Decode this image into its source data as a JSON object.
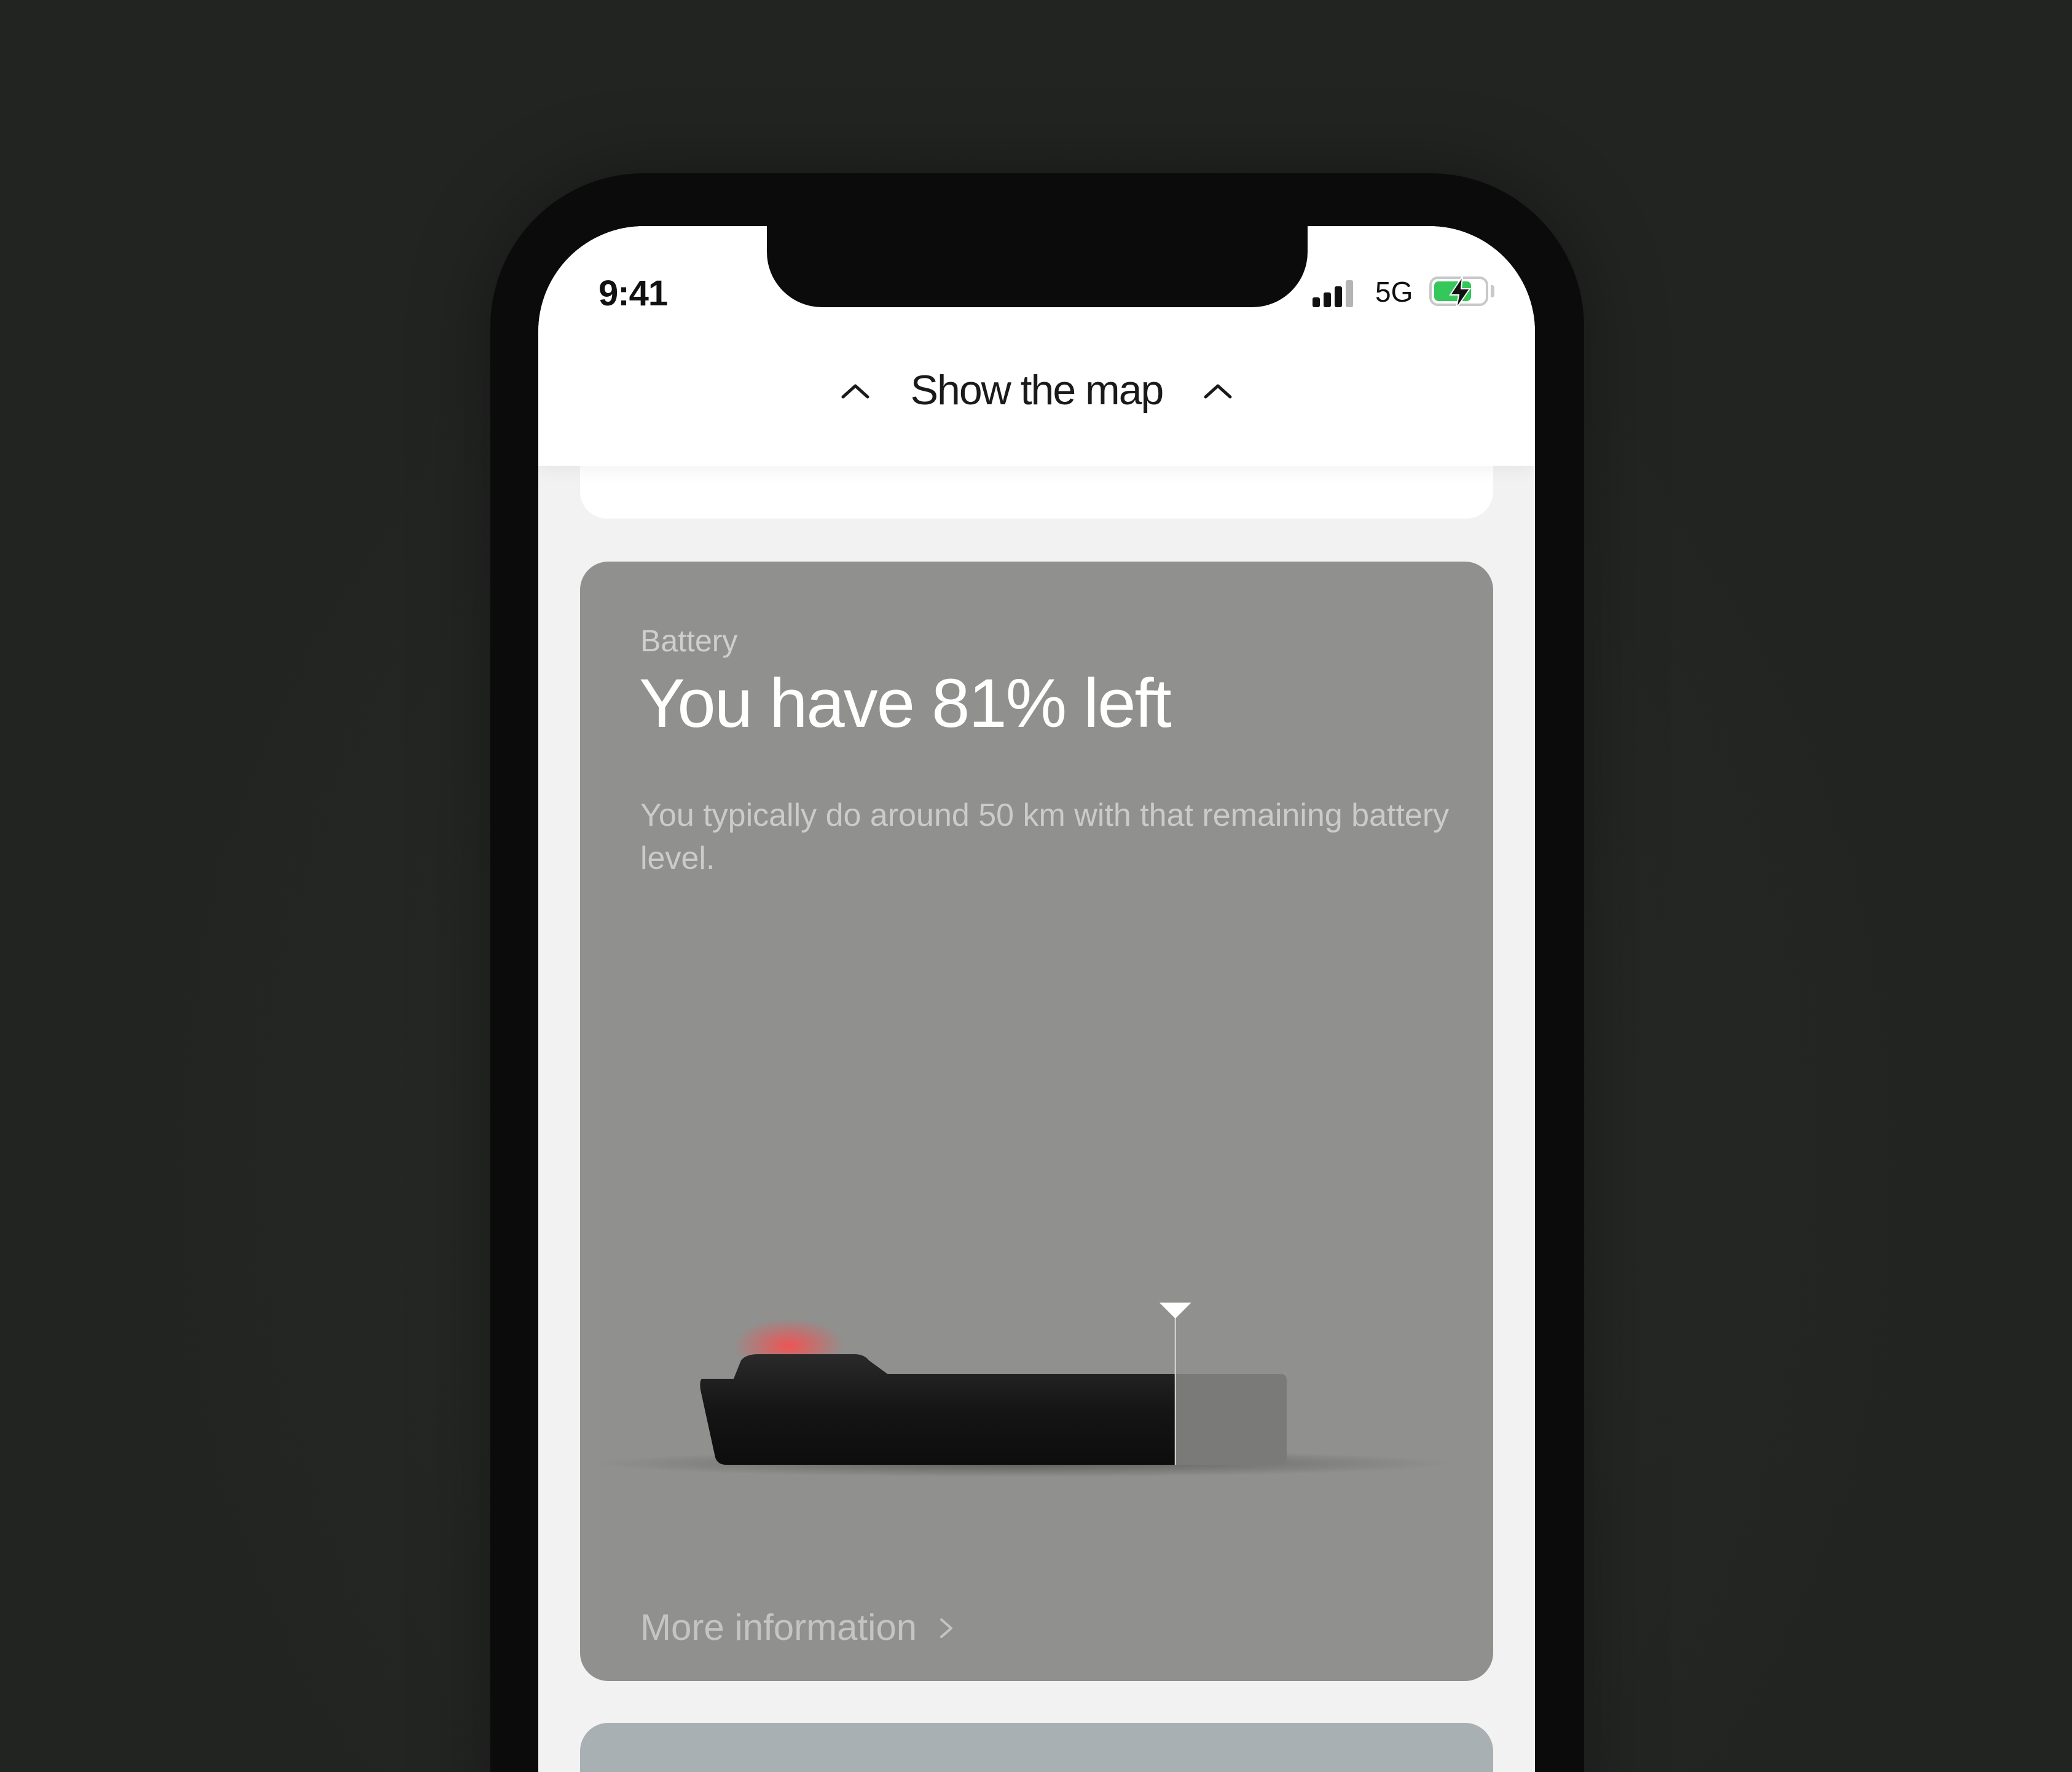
{
  "status_bar": {
    "time": "9:41",
    "network": "5G",
    "battery_fraction": 0.75,
    "charging": true,
    "signal_bars_active": 3
  },
  "header": {
    "title": "Show the map"
  },
  "battery_card": {
    "label": "Battery",
    "headline": "You have 81% left",
    "description": "You typically do around 50 km with that remaining battery level.",
    "level_fraction": 0.81,
    "link_label": "More information"
  },
  "colors": {
    "card_background": "#90908e",
    "charging_green": "#34c759",
    "indicator_light": "#ff4a4a",
    "next_card": "#a9b0b4"
  },
  "icons": [
    "chevron-up-icon",
    "chevron-right-icon",
    "signal-icon",
    "battery-icon",
    "bolt-icon",
    "marker-triangle-icon"
  ]
}
